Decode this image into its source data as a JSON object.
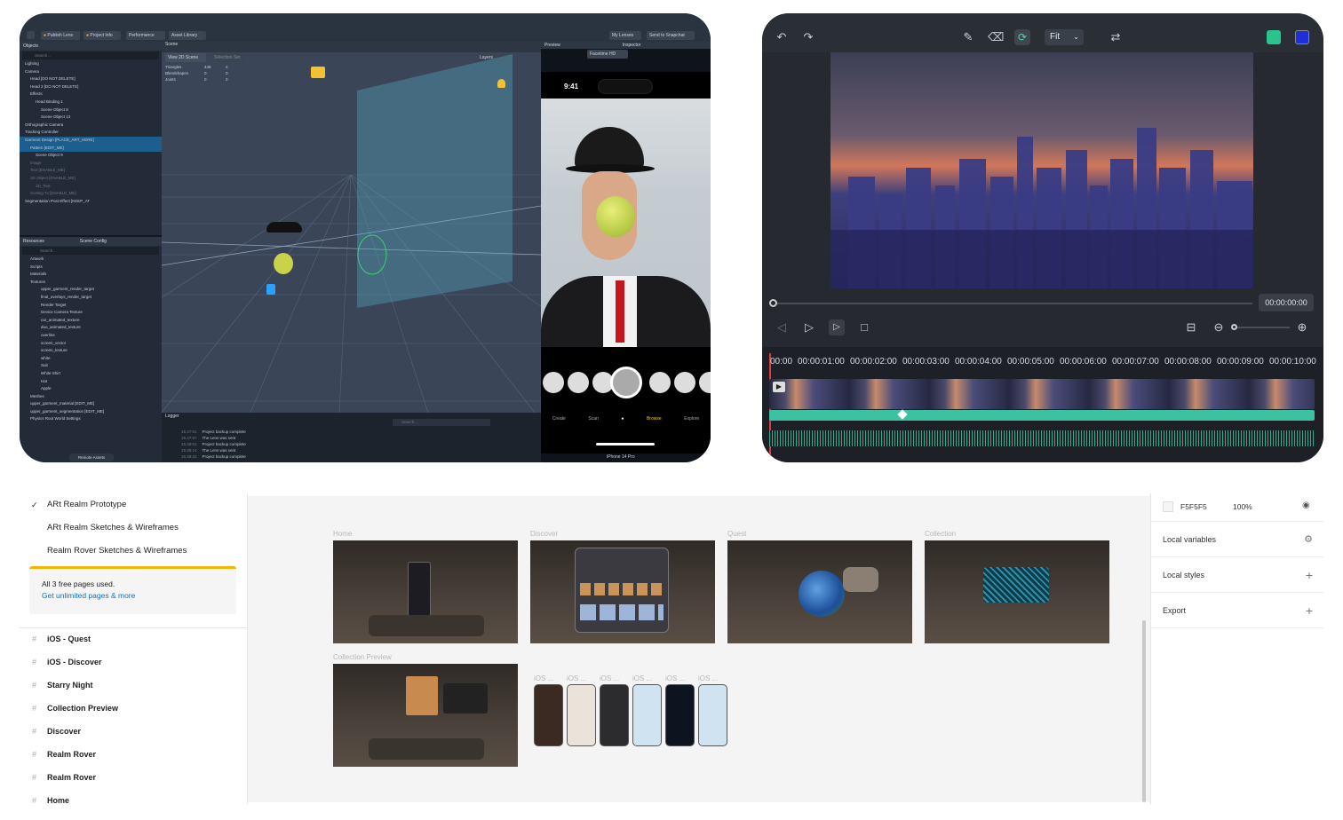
{
  "lens_studio": {
    "toolbar": {
      "publish": "Publish Lens",
      "project_info": "Project Info",
      "performance": "Performance",
      "asset_library": "Asset Library",
      "my_lenses": "My Lenses",
      "send": "Send to Snapchat"
    },
    "objects_panel": {
      "title": "Objects",
      "search_placeholder": "Search...",
      "items": [
        "Lighting",
        "Camera",
        "Head [DO NOT DELETE]",
        "Head 2 [DO NOT DELETE]",
        "Effects",
        "Head Binding 1",
        "Scene Object 8",
        "Scene Object 13",
        "Orthographic Camera",
        "Tracking Controller",
        "Garment Design [PLACE_ART_HERE]",
        "Pattern [EDIT_ME]",
        "Scene Object 9",
        "Image",
        "Text [ENABLE_ME]",
        "3D Object [ENABLE_ME]",
        "3D_Text",
        "Scaling Tx [ENABLE_ME]",
        "Segmentation Post Effect [KEEP_AT"
      ]
    },
    "resources_panel": {
      "title": "Resources",
      "tab2": "Scene Config",
      "search_placeholder": "Search...",
      "items": [
        "Artwork",
        "Scripts",
        "Materials",
        "Textures",
        "upper_garment_render_target",
        "final_overlays_render_target",
        "Render Target",
        "Device Camera Texture",
        "car_animated_texture",
        "duo_animated_texture",
        "overline",
        "screen_vector",
        "screen_texture",
        "white",
        "Suit",
        "White Shirt",
        "Hat",
        "Apple",
        "Meshes",
        "upper_garment_material [EDIT_ME]",
        "upper_garment_segmentation [EDIT_ME]",
        "Physics Root World Settings"
      ],
      "footer": "Remote Assets"
    },
    "scene": {
      "title": "Scene",
      "view_mode": "View 2D Scene",
      "selection_set": "Selection Set",
      "layers": "Layers",
      "stats": [
        {
          "label": "Triangles",
          "a": "448",
          "b": "2"
        },
        {
          "label": "Blendshapes",
          "a": "0",
          "b": "0"
        },
        {
          "label": "Joints",
          "a": "0",
          "b": "0"
        }
      ]
    },
    "logger": {
      "title": "Logger",
      "search_placeholder": "Search...",
      "lines": [
        {
          "time": "15:47:51",
          "text": "Project backup complete"
        },
        {
          "time": "15:47:57",
          "text": "The Lens was sent"
        },
        {
          "time": "15:48:01",
          "text": "Project backup complete"
        },
        {
          "time": "15:48:14",
          "text": "The Lens was sent"
        },
        {
          "time": "15:48:22",
          "text": "Project backup complete"
        }
      ]
    },
    "preview": {
      "title": "Preview",
      "inspector": "Inspector",
      "camera_source": "Facetime HD",
      "phone_time": "9:41",
      "bottom_tabs": [
        "Create",
        "Scan",
        "",
        "Browse",
        "Explore"
      ],
      "device": "iPhone 14 Pro"
    }
  },
  "video_editor": {
    "fit_label": "Fit",
    "timecode": "00:00:00:00",
    "ruler": [
      "00:00",
      "00:00:01:00",
      "00:00:02:00",
      "00:00:03:00",
      "00:00:04:00",
      "00:00:05:00",
      "00:00:06:00",
      "00:00:07:00",
      "00:00:08:00",
      "00:00:09:00",
      "00:00:10:00"
    ]
  },
  "figma": {
    "pages": [
      {
        "label": "ARt Realm Prototype",
        "checked": true
      },
      {
        "label": "ARt Realm Sketches & Wireframes",
        "checked": false
      },
      {
        "label": "Realm Rover Sketches & Wireframes",
        "checked": false
      }
    ],
    "upsell": {
      "text": "All 3 free pages used.",
      "link": "Get unlimited pages & more"
    },
    "layers": [
      "iOS - Quest",
      "iOS - Discover",
      "Starry Night",
      "Collection Preview",
      "Discover",
      "Realm Rover",
      "Realm Rover",
      "Home"
    ],
    "frames": [
      "Home",
      "Discover",
      "Quest",
      "Collection",
      "Collection Preview"
    ],
    "ios_labels": [
      "iOS ...",
      "iOS ...",
      "iOS ...",
      "iOS ...",
      "iOS ...",
      "iOS ..."
    ],
    "right": {
      "bg_hex": "F5F5F5",
      "bg_opacity": "100%",
      "local_variables": "Local variables",
      "local_styles": "Local styles",
      "export": "Export"
    }
  }
}
